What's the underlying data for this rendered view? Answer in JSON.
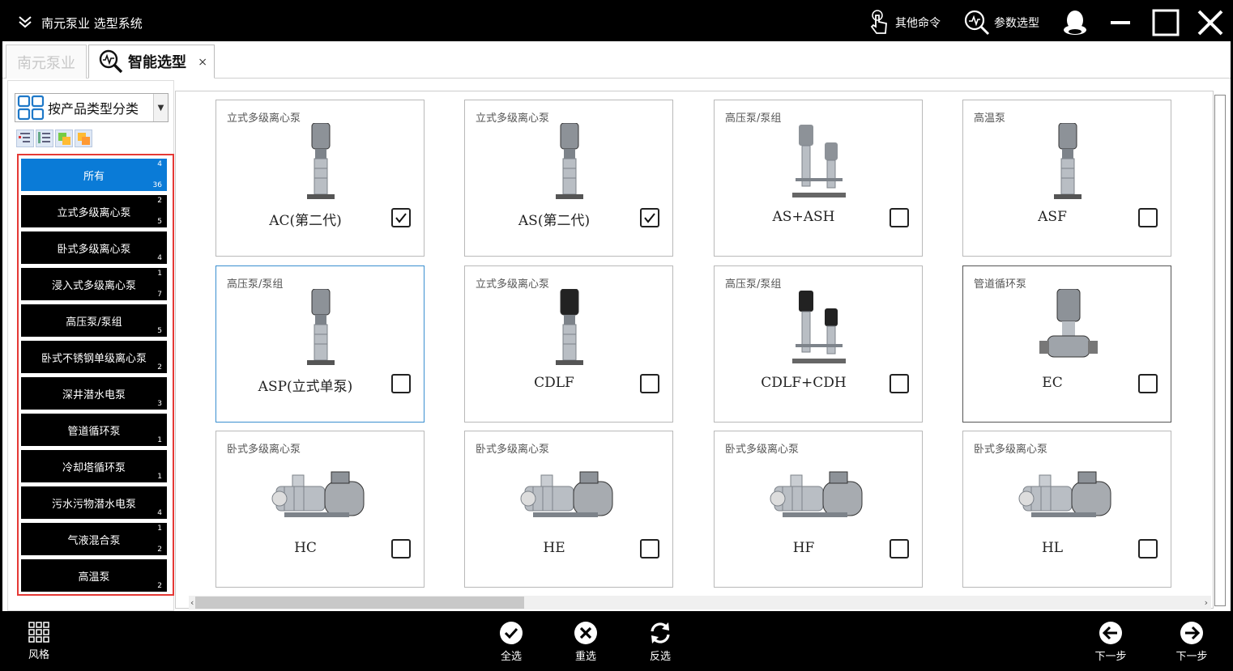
{
  "app": {
    "title": "南元泵业 选型系统",
    "commands": [
      {
        "label": "其他命令",
        "icon": "touch-hand-icon"
      },
      {
        "label": "参数选型",
        "icon": "search-chart-icon"
      }
    ]
  },
  "tabs": [
    {
      "label": "南元泵业",
      "active": false
    },
    {
      "label": "智能选型",
      "active": true,
      "close": "×"
    }
  ],
  "sidebar": {
    "selector_label": "按产品类型分类",
    "categories": [
      {
        "label": "所有",
        "top": "4",
        "bottom": "36",
        "active": true
      },
      {
        "label": "立式多级离心泵",
        "top": "2",
        "bottom": "5"
      },
      {
        "label": "卧式多级离心泵",
        "top": "",
        "bottom": "4"
      },
      {
        "label": "浸入式多级离心泵",
        "top": "1",
        "bottom": "7"
      },
      {
        "label": "高压泵/泵组",
        "top": "",
        "bottom": "5"
      },
      {
        "label": "卧式不锈钢单级离心泵",
        "top": "",
        "bottom": "2"
      },
      {
        "label": "深井潜水电泵",
        "top": "",
        "bottom": "3"
      },
      {
        "label": "管道循环泵",
        "top": "",
        "bottom": "1"
      },
      {
        "label": "冷却塔循环泵",
        "top": "",
        "bottom": "1"
      },
      {
        "label": "污水污物潜水电泵",
        "top": "",
        "bottom": "4"
      },
      {
        "label": "气液混合泵",
        "top": "1",
        "bottom": "2"
      },
      {
        "label": "高温泵",
        "top": "",
        "bottom": "2"
      }
    ]
  },
  "products": [
    {
      "category": "立式多级离心泵",
      "name": "AC(第二代)",
      "checked": true,
      "pump": "vertical-single"
    },
    {
      "category": "立式多级离心泵",
      "name": "AS(第二代)",
      "checked": true,
      "pump": "vertical-single"
    },
    {
      "category": "高压泵/泵组",
      "name": "AS+ASH",
      "checked": false,
      "pump": "vertical-pair"
    },
    {
      "category": "高温泵",
      "name": "ASF",
      "checked": false,
      "pump": "vertical-single"
    },
    {
      "category": "高压泵/泵组",
      "name": "ASP(立式单泵)",
      "checked": false,
      "pump": "vertical-single"
    },
    {
      "category": "立式多级离心泵",
      "name": "CDLF",
      "checked": false,
      "pump": "vertical-dark"
    },
    {
      "category": "高压泵/泵组",
      "name": "CDLF+CDH",
      "checked": false,
      "pump": "vertical-pair-dark"
    },
    {
      "category": "管道循环泵",
      "name": "EC",
      "checked": false,
      "pump": "inline"
    },
    {
      "category": "卧式多级离心泵",
      "name": "HC",
      "checked": false,
      "pump": "horizontal"
    },
    {
      "category": "卧式多级离心泵",
      "name": "HE",
      "checked": false,
      "pump": "horizontal"
    },
    {
      "category": "卧式多级离心泵",
      "name": "HF",
      "checked": false,
      "pump": "horizontal"
    },
    {
      "category": "卧式多级离心泵",
      "name": "HL",
      "checked": false,
      "pump": "horizontal"
    }
  ],
  "bottombar": {
    "style": "风格",
    "select_all": "全选",
    "reset": "重选",
    "invert": "反选",
    "prev": "下一步",
    "next": "下一步"
  }
}
